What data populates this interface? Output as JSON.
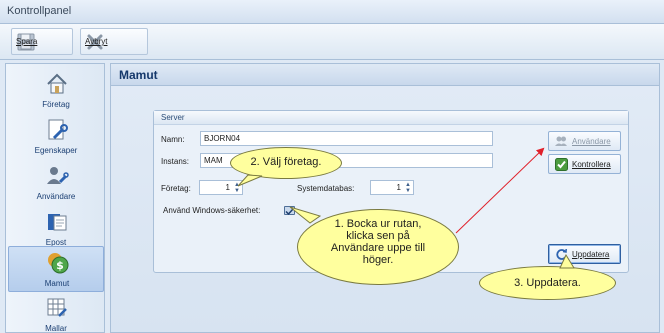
{
  "window": {
    "title": "Kontrollpanel"
  },
  "toolbar": {
    "save_label": "Spara",
    "cancel_label": "Avbryt",
    "save_icon": "floppy-disk-icon",
    "cancel_icon": "close-x-icon"
  },
  "sidebar": {
    "items": [
      {
        "label": "Företag",
        "icon": "house-icon",
        "active": false
      },
      {
        "label": "Egenskaper",
        "icon": "document-wrench-icon",
        "active": false
      },
      {
        "label": "Användare",
        "icon": "users-icon",
        "active": false
      },
      {
        "label": "Epost",
        "icon": "mail-icon",
        "active": false
      },
      {
        "label": "Mamut",
        "icon": "coins-dollar-icon",
        "active": true
      },
      {
        "label": "Mallar",
        "icon": "template-grid-icon",
        "active": false
      }
    ]
  },
  "main": {
    "title": "Mamut",
    "server_group": {
      "title": "Server",
      "name_label": "Namn:",
      "name_value": "BJORN04",
      "instance_label": "Instans:",
      "instance_value": "MAM",
      "company_label": "Företag:",
      "company_value": "1",
      "sysdb_label": "Systemdatabas:",
      "sysdb_value": "1",
      "windows_security_label": "Använd Windows-säkerhet:",
      "windows_security_checked": true
    },
    "buttons": {
      "users_label": "Användare",
      "check_label": "Kontrollera",
      "update_label": "Uppdatera"
    }
  },
  "callouts": {
    "step2": "2. Välj företag.",
    "step1_lines": [
      "1. Bocka ur rutan,",
      "klicka sen på",
      "Användare uppe till",
      "höger."
    ],
    "step3": "3. Uppdatera."
  },
  "colors": {
    "accent": "#15386b",
    "callout_fill": "#ffff9e",
    "arrow": "#e0202a"
  }
}
